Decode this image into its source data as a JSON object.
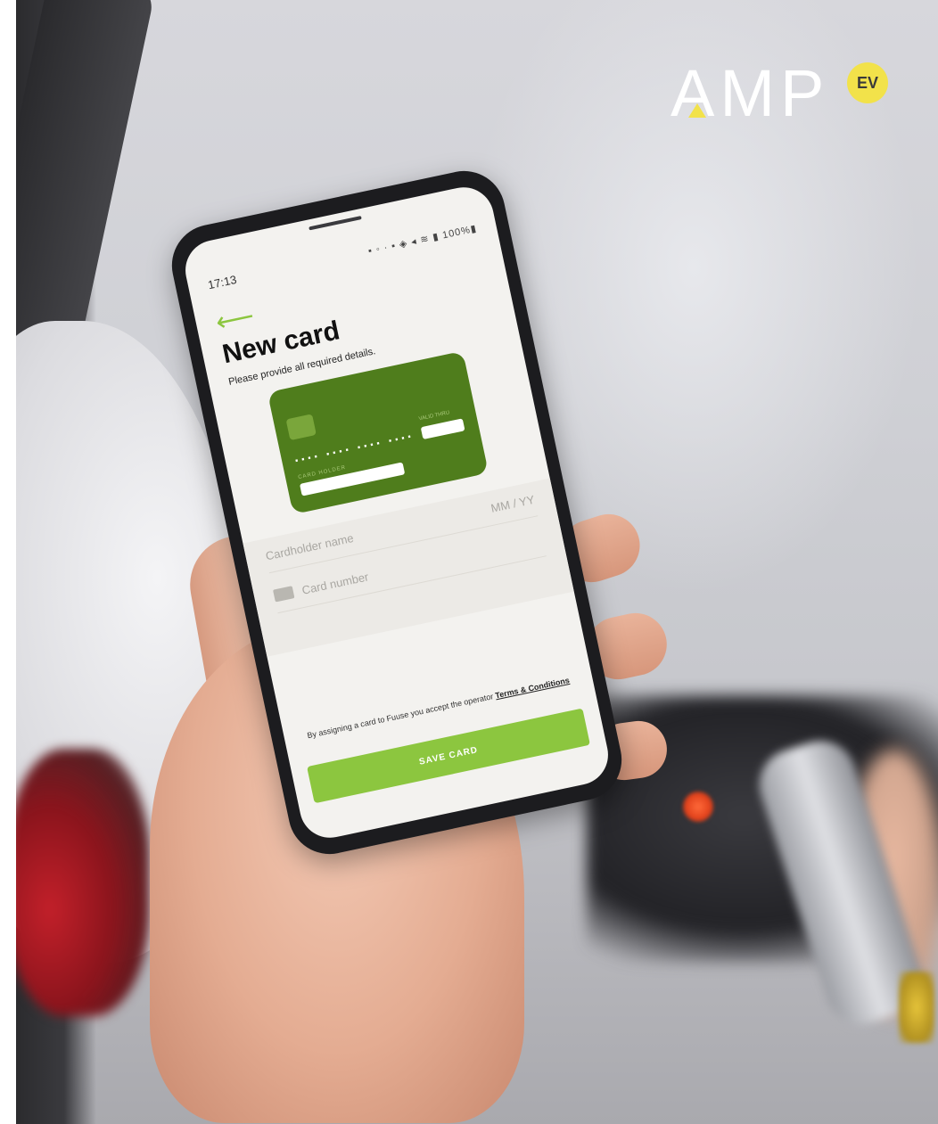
{
  "brand": {
    "name": "AMP",
    "badge": "EV",
    "accent_color": "#f2e24a"
  },
  "phone": {
    "status_bar": {
      "time": "17:13",
      "icons": "▪ ◦ · ▪ ◈ ◂ ≋ ▮ 100%▮",
      "battery": "100%"
    },
    "screen": {
      "back_icon": "arrow-left-icon",
      "title": "New card",
      "subtitle": "Please provide all required details.",
      "card_visual": {
        "number_mask": "···· ···· ···· ····",
        "holder_label": "CARD HOLDER",
        "valid_label": "VALID THRU",
        "color": "#4f7d1c"
      },
      "form": {
        "cardholder_placeholder": "Cardholder name",
        "expiry_placeholder": "MM / YY",
        "card_number_placeholder": "Card number"
      },
      "terms_text": "By assigning a card to Fuuse you accept the operator",
      "terms_link": "Terms & Conditions",
      "save_button": "SAVE CARD",
      "accent_color": "#8cc63f"
    }
  }
}
